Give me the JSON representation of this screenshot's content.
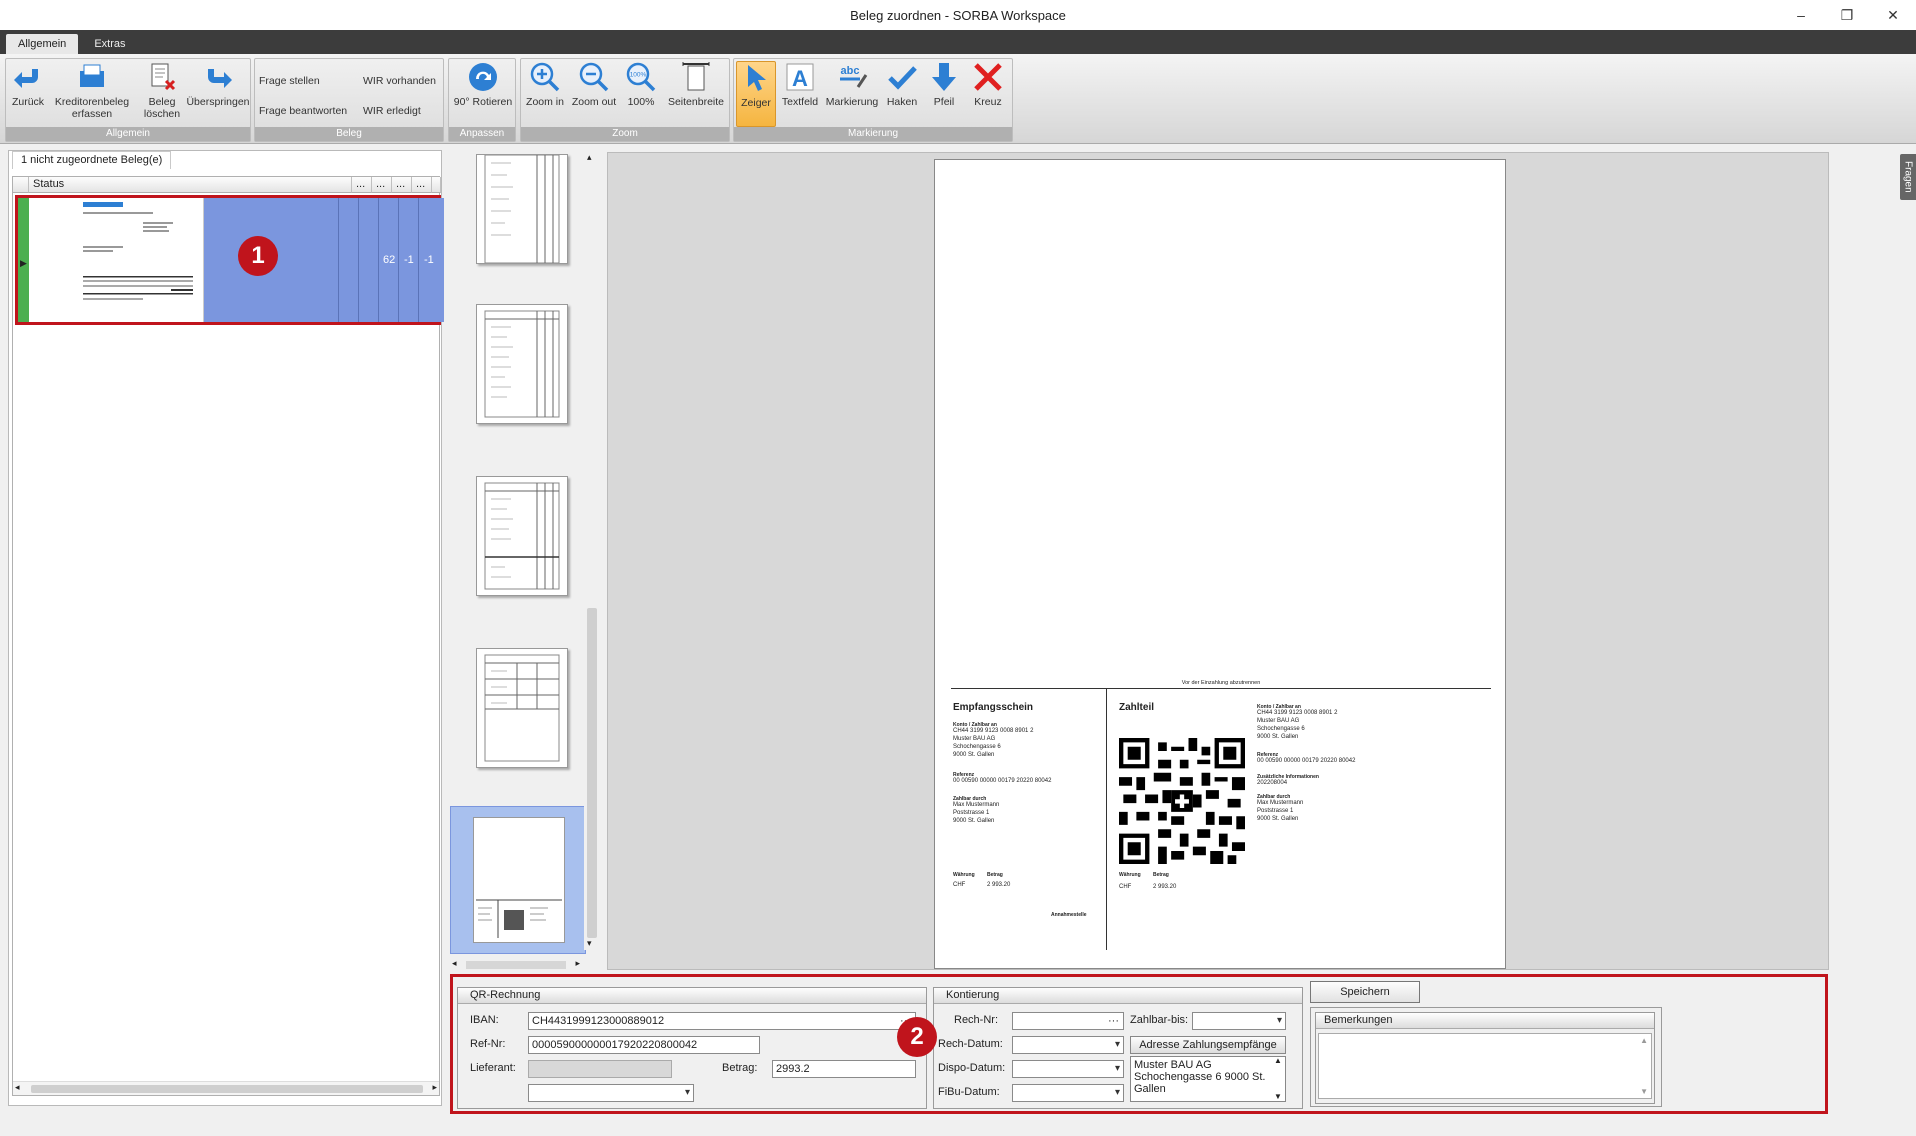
{
  "window": {
    "title": "Beleg zuordnen - SORBA Workspace"
  },
  "ribbon": {
    "tabs": [
      "Allgemein",
      "Extras"
    ],
    "groups": {
      "allgemein": {
        "caption": "Allgemein",
        "zurueck": "Zurück",
        "kreditoren": "Kreditorenbeleg erfassen",
        "loeschen": "Beleg löschen",
        "ueberspringen": "Überspringen"
      },
      "beleg": {
        "caption": "Beleg",
        "frage_stellen": "Frage stellen",
        "frage_beantworten": "Frage beantworten",
        "wir_vorhanden": "WIR vorhanden",
        "wir_erledigt": "WIR erledigt"
      },
      "anpassen": {
        "caption": "Anpassen",
        "rotieren": "90° Rotieren"
      },
      "zoom": {
        "caption": "Zoom",
        "zoom_in": "Zoom in",
        "zoom_out": "Zoom out",
        "hundred": "100%",
        "seitenbreite": "Seitenbreite"
      },
      "markierung": {
        "caption": "Markierung",
        "zeiger": "Zeiger",
        "textfeld": "Textfeld",
        "markierung": "Markierung",
        "haken": "Haken",
        "pfeil": "Pfeil",
        "kreuz": "Kreuz"
      }
    }
  },
  "left": {
    "tab": "1 nicht zugeordnete Beleg(e)",
    "columns": [
      "Status",
      "...",
      "...",
      "...",
      "...",
      "..."
    ],
    "row": {
      "c1": "62",
      "c2": "-1",
      "c3": "-1"
    },
    "badge": "1"
  },
  "side_tab": "Fragen",
  "document": {
    "cut_line": "Vor der Einzahlung abzutrennen",
    "receipt": {
      "title": "Empfangsschein",
      "konto_label": "Konto / Zahlbar an",
      "iban": "CH44 3199 9123 0008 8901 2",
      "name": "Muster BAU AG",
      "street": "Schochengasse 6",
      "city": "9000 St. Gallen",
      "ref_label": "Referenz",
      "ref": "00 00590 00000 00179 20220 80042",
      "payer_label": "Zahlbar durch",
      "payer_name": "Max Mustermann",
      "payer_street": "Poststrasse 1",
      "payer_city": "9000 St. Gallen",
      "currency_label": "Währung",
      "amount_label": "Betrag",
      "currency": "CHF",
      "amount": "2 993.20",
      "acceptance": "Annahmestelle"
    },
    "payment": {
      "title": "Zahlteil",
      "konto_label": "Konto / Zahlbar an",
      "iban": "CH44 3199 9123 0008 8901 2",
      "name": "Muster BAU AG",
      "street": "Schochengasse 6",
      "city": "9000 St. Gallen",
      "ref_label": "Referenz",
      "ref": "00 00590 00000 00179 20220 80042",
      "info_label": "Zusätzliche Informationen",
      "info": "202208004",
      "payer_label": "Zahlbar durch",
      "payer_name": "Max Mustermann",
      "payer_street": "Poststrasse 1",
      "payer_city": "9000 St. Gallen",
      "currency_label": "Währung",
      "amount_label": "Betrag",
      "currency": "CHF",
      "amount": "2 993.20"
    }
  },
  "qr": {
    "title": "QR-Rechnung",
    "iban_label": "IBAN:",
    "iban": "CH4431999123000889012",
    "ref_label": "Ref-Nr:",
    "ref": "000059000000017920220800042",
    "lieferant_label": "Lieferant:",
    "betrag_label": "Betrag:",
    "betrag": "2993.2"
  },
  "kontierung": {
    "title": "Kontierung",
    "rech_nr": "Rech-Nr:",
    "zahlbar_bis": "Zahlbar-bis:",
    "rech_datum": "Rech-Datum:",
    "dispo_datum": "Dispo-Datum:",
    "fibu_datum": "FiBu-Datum:",
    "adresse_btn": "Adresse Zahlungsempfänge",
    "adresse": "Muster BAU AG Schochengasse 6 9000 St. Gallen"
  },
  "speichern": "Speichern",
  "bemerkungen": "Bemerkungen",
  "badge2": "2",
  "colors": {
    "accent": "#c0141c",
    "selection": "#7b96de",
    "status_green": "#4caf50",
    "icon_blue": "#2d7fd3"
  }
}
